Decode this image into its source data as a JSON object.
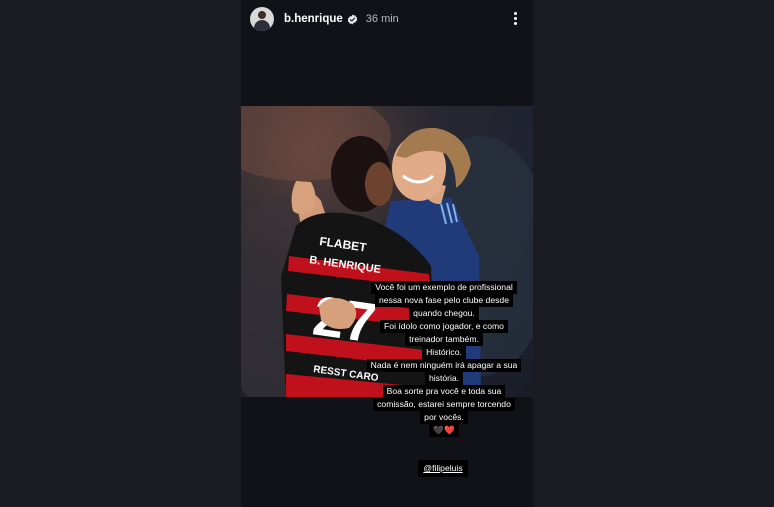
{
  "header": {
    "username": "b.henrique",
    "time_ago": "36 min",
    "verified_icon": "verified-badge-icon",
    "more_icon": "more-vertical-icon"
  },
  "photo": {
    "jersey_sponsor": "FLABET",
    "jersey_name": "B. HENRIQUE",
    "jersey_number": "27",
    "jersey_sleeve": "RESST CARO"
  },
  "caption": {
    "lines": [
      "Você foi um exemplo de profissional",
      "nessa nova fase pelo clube desde",
      "quando chegou.",
      "Foi ídolo como jogador, e como",
      "treinador também.",
      "Histórico.",
      "Nada é nem ninguém irá apagar a sua",
      "história.",
      "Boa sorte pra você e toda sua",
      "comissão, estarei sempre torcendo",
      "por vocês.",
      "🖤❤️"
    ]
  },
  "mention": "@filipeluis",
  "colors": {
    "background": "#1b1c21",
    "story_background": "#101217",
    "flamengo_red": "#c0101c",
    "flamengo_black": "#141414",
    "navy_jersey": "#213a7a"
  }
}
